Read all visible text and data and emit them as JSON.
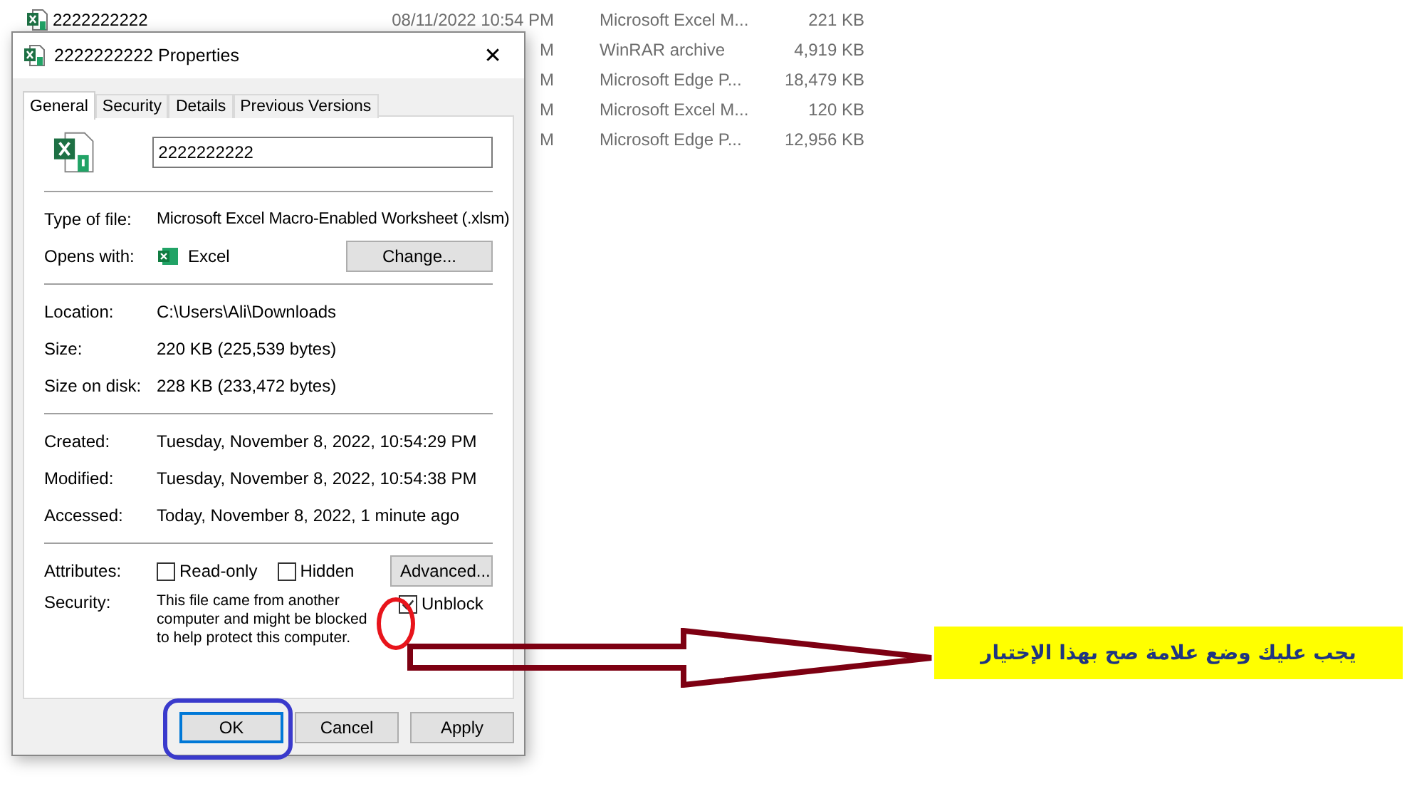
{
  "file_list": {
    "rows": [
      {
        "name": "2222222222",
        "date": "08/11/2022 10:54 PM",
        "type": "Microsoft Excel M...",
        "size": "221 KB"
      },
      {
        "date": "M",
        "type": "WinRAR archive",
        "size": "4,919 KB"
      },
      {
        "date": "M",
        "type": "Microsoft Edge P...",
        "size": "18,479 KB"
      },
      {
        "date": "M",
        "type": "Microsoft Excel M...",
        "size": "120 KB"
      },
      {
        "date": "M",
        "type": "Microsoft Edge P...",
        "size": "12,956 KB"
      }
    ]
  },
  "dialog": {
    "title": "2222222222 Properties",
    "close": "✕",
    "tabs": [
      {
        "label": "General",
        "selected": true
      },
      {
        "label": "Security",
        "selected": false
      },
      {
        "label": "Details",
        "selected": false
      },
      {
        "label": "Previous Versions",
        "selected": false
      }
    ],
    "file_name": "2222222222",
    "type_of_file": {
      "label": "Type of file:",
      "value": "Microsoft Excel Macro-Enabled Worksheet (.xlsm)"
    },
    "opens_with": {
      "label": "Opens with:",
      "app": "Excel",
      "button": "Change..."
    },
    "location_group": [
      {
        "label": "Location:",
        "value": "C:\\Users\\Ali\\Downloads"
      },
      {
        "label": "Size:",
        "value": "220 KB (225,539 bytes)"
      },
      {
        "label": "Size on disk:",
        "value": "228 KB (233,472 bytes)"
      }
    ],
    "dates_group": [
      {
        "label": "Created:",
        "value": "Tuesday, November 8, 2022, 10:54:29 PM"
      },
      {
        "label": "Modified:",
        "value": "Tuesday, November 8, 2022, 10:54:38 PM"
      },
      {
        "label": "Accessed:",
        "value": "Today, November 8, 2022, 1 minute ago"
      }
    ],
    "attributes": {
      "label": "Attributes:",
      "checkboxes": [
        {
          "label": "Read-only",
          "checked": false
        },
        {
          "label": "Hidden",
          "checked": false
        }
      ],
      "button": "Advanced..."
    },
    "security": {
      "label": "Security:",
      "text": "This file came from another computer and might be blocked to help protect this computer.",
      "unblock": {
        "label": "Unblock",
        "checked": true
      }
    },
    "buttons": [
      {
        "label": "OK",
        "focused": true
      },
      {
        "label": "Cancel",
        "focused": false
      },
      {
        "label": "Apply",
        "focused": false
      }
    ]
  },
  "annotation": {
    "callout": "يجب عليك وضع علامة صح بهذا الإختيار"
  }
}
